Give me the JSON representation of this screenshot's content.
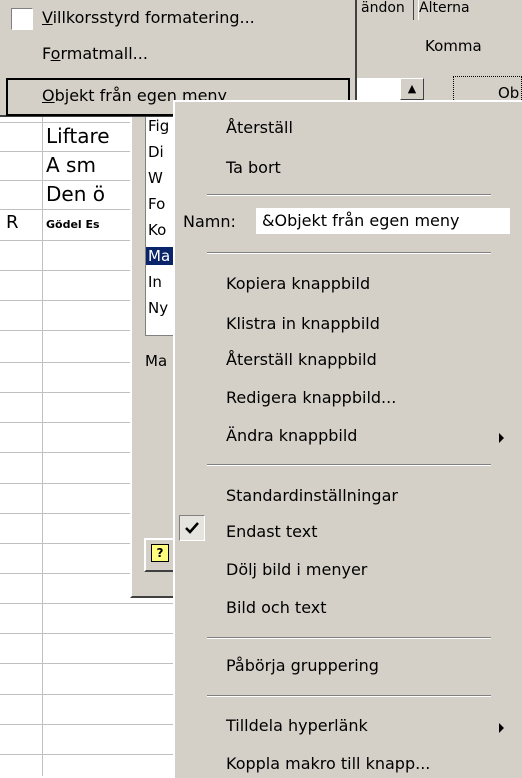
{
  "format_menu": {
    "items": [
      {
        "label": "Villkorsstyrd formatering...",
        "accel": "V"
      },
      {
        "label": "Formatmall...",
        "accel": "o"
      },
      {
        "label": "Objekt från egen meny",
        "accel": "O"
      }
    ]
  },
  "top_right": {
    "tab_partial_1": "ändon",
    "tab_partial_2": "Alterna",
    "commands_label": "Komma",
    "scroll_up": "▲",
    "button_partial": "Ob"
  },
  "sheet": {
    "rows": [
      {
        "text": "Liftare"
      },
      {
        "text": "A sm"
      },
      {
        "text": "Den ö"
      },
      {
        "text": "Gödel Es",
        "small": true
      }
    ],
    "left_fragment": "R"
  },
  "dialog": {
    "list_items": [
      "Fig",
      "Di",
      "W",
      "Fo",
      "Ko",
      "Ma",
      "In",
      "Ny"
    ],
    "selected_index": 5,
    "macro_label": "Ma",
    "help_icon": "?"
  },
  "context_menu": {
    "reset": "Återställ",
    "delete": "Ta bort",
    "name_label": "Namn:",
    "name_value": "&Objekt från egen meny",
    "copy_image": "Kopiera knappbild",
    "paste_image": "Klistra in knappbild",
    "reset_image": "Återställ knappbild",
    "edit_image": "Redigera knappbild...",
    "change_image": "Ändra knappbild",
    "default_style": "Standardinställningar",
    "text_only": "Endast text",
    "hide_image": "Dölj bild i menyer",
    "image_and_text": "Bild och text",
    "begin_group": "Påbörja gruppering",
    "assign_hyperlink": "Tilldela hyperlänk",
    "assign_macro": "Koppla makro till knapp..."
  },
  "colors": {
    "menu_bg": "#d4d0c8",
    "selection": "#0a246a"
  }
}
